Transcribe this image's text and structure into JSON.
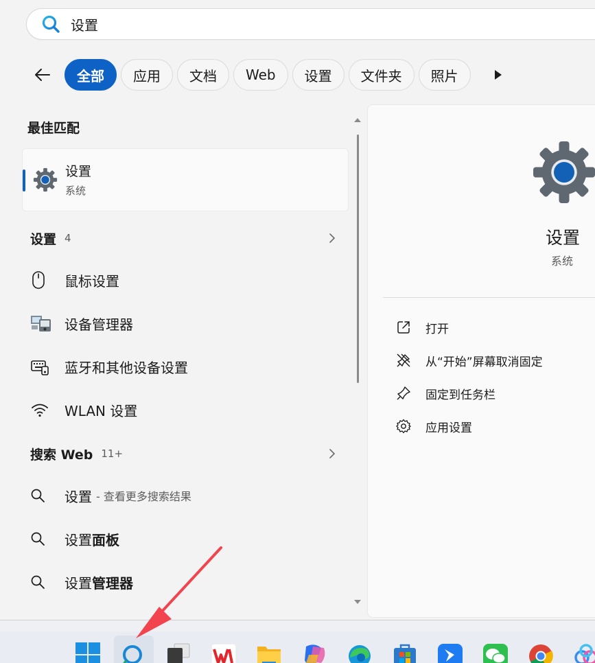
{
  "search": {
    "value": "设置"
  },
  "filters": [
    {
      "label": "全部",
      "active": true
    },
    {
      "label": "应用"
    },
    {
      "label": "文档"
    },
    {
      "label": "Web"
    },
    {
      "label": "设置"
    },
    {
      "label": "文件夹"
    },
    {
      "label": "照片"
    }
  ],
  "best_match": {
    "header": "最佳匹配",
    "title": "设置",
    "subtitle": "系统"
  },
  "settings_group": {
    "title": "设置",
    "count": "4",
    "items": [
      {
        "label": "鼠标设置",
        "icon": "mouse-icon"
      },
      {
        "label": "设备管理器",
        "icon": "device-manager-icon"
      },
      {
        "label": "蓝牙和其他设备设置",
        "icon": "bluetooth-devices-icon"
      },
      {
        "label": "WLAN 设置",
        "icon": "wifi-icon"
      }
    ]
  },
  "web_group": {
    "title": "搜索 Web",
    "count": "11+",
    "items": [
      {
        "main": "设置",
        "suffix": " - 查看更多搜索结果"
      },
      {
        "main": "设置",
        "bold": "面板"
      },
      {
        "main": "设置",
        "bold": "管理器"
      }
    ]
  },
  "detail": {
    "title": "设置",
    "subtitle": "系统",
    "actions": [
      {
        "label": "打开",
        "icon": "open-external-icon"
      },
      {
        "label": "从“开始”屏幕取消固定",
        "icon": "unpin-icon"
      },
      {
        "label": "固定到任务栏",
        "icon": "pin-icon"
      },
      {
        "label": "应用设置",
        "icon": "gear-icon"
      }
    ]
  },
  "colors": {
    "accent": "#0f62c5",
    "arrow": "#f2444e"
  }
}
